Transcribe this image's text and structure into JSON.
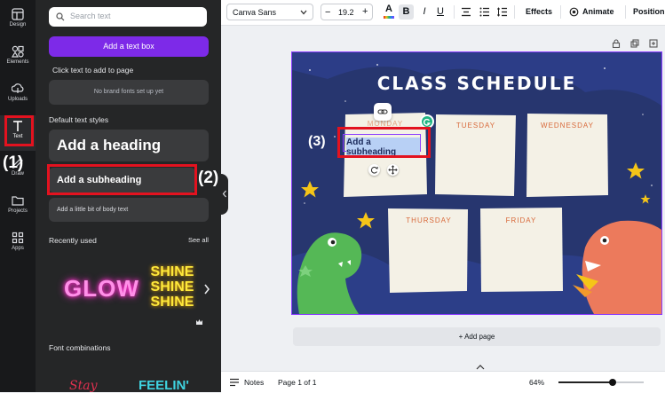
{
  "sidebar": {
    "items": [
      {
        "label": "Design",
        "icon": "design-icon"
      },
      {
        "label": "Elements",
        "icon": "elements-icon"
      },
      {
        "label": "Uploads",
        "icon": "upload-icon"
      },
      {
        "label": "Text",
        "icon": "text-icon"
      },
      {
        "label": "Draw",
        "icon": "draw-icon"
      },
      {
        "label": "Projects",
        "icon": "folder-icon"
      },
      {
        "label": "Apps",
        "icon": "apps-icon"
      }
    ]
  },
  "panel": {
    "search_placeholder": "Search text",
    "add_textbox_label": "Add a text box",
    "click_hint": "Click text to add to page",
    "brand_fonts_msg": "No brand fonts set up yet",
    "default_styles_title": "Default text styles",
    "heading": "Add a heading",
    "subheading": "Add a subheading",
    "body": "Add a little bit of body text",
    "recently_used_title": "Recently used",
    "see_all": "See all",
    "recent1": "GLOW",
    "recent2": "SHINE SHINE SHINE",
    "font_combinations_title": "Font combinations",
    "combo1": "Stay",
    "combo2": "FEELIN'"
  },
  "annotations": {
    "a1": "(1)",
    "a2": "(2)",
    "a3": "(3)"
  },
  "toolbar": {
    "font": "Canva Sans",
    "minus": "−",
    "size": "19.2",
    "plus": "+",
    "text_color_glyph": "A",
    "bold": "B",
    "italic": "I",
    "underline": "U",
    "effects": "Effects",
    "animate": "Animate",
    "position": "Position"
  },
  "canvas": {
    "title": "CLASS SCHEDULE",
    "days": [
      "MONDAY",
      "TUESDAY",
      "WEDNESDAY",
      "THURSDAY",
      "FRIDAY"
    ],
    "selected_text": "Add a subheading"
  },
  "add_page_label": "+ Add page",
  "bottom": {
    "notes": "Notes",
    "page": "Page 1 of 1",
    "zoom": "64%",
    "zoom_level": 0.64
  },
  "colors": {
    "accent": "#7d2ae8",
    "annotation_red": "#e3121f",
    "canvas_bg": "#27366f"
  }
}
